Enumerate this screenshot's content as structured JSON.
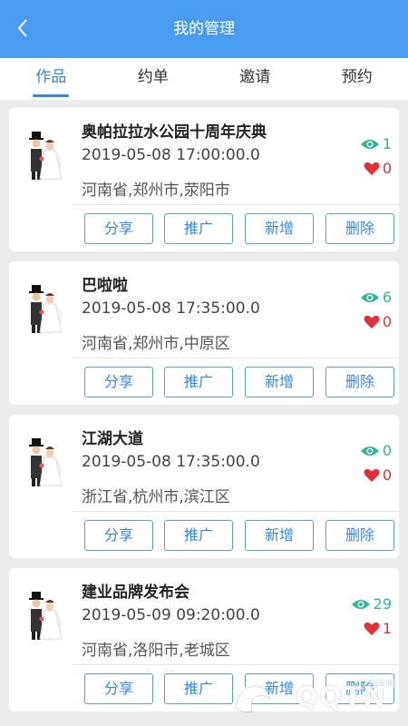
{
  "header": {
    "title": "我的管理"
  },
  "tabs": [
    {
      "label": "作品",
      "active": true
    },
    {
      "label": "约单",
      "active": false
    },
    {
      "label": "邀请",
      "active": false
    },
    {
      "label": "预约",
      "active": false
    }
  ],
  "colors": {
    "header_bg": "#4a9cf0",
    "accent": "#3a86e6",
    "views": "#31b795",
    "likes": "#e0303a"
  },
  "icons": {
    "back": "chevron-left-icon",
    "views": "eye-icon",
    "likes": "heart-icon"
  },
  "cards": [
    {
      "title": "奥帕拉拉水公园十周年庆典",
      "time": "2019-05-08 17:00:00.0",
      "location": "河南省,郑州市,荥阳市",
      "views": "1",
      "likes": "0"
    },
    {
      "title": "巴啦啦",
      "time": "2019-05-08 17:35:00.0",
      "location": "河南省,郑州市,中原区",
      "views": "6",
      "likes": "0"
    },
    {
      "title": "江湖大道",
      "time": "2019-05-08 17:35:00.0",
      "location": "浙江省,杭州市,滨江区",
      "views": "0",
      "likes": "0"
    },
    {
      "title": "建业品牌发布会",
      "time": "2019-05-09 09:20:00.0",
      "location": "河南省,洛阳市,老城区",
      "views": "29",
      "likes": "1"
    }
  ],
  "actions": {
    "share": "分享",
    "promote": "推广",
    "add": "新增",
    "delete": "删除"
  },
  "watermark": {
    "brand": "QQTN",
    "site": "腾牛网"
  }
}
